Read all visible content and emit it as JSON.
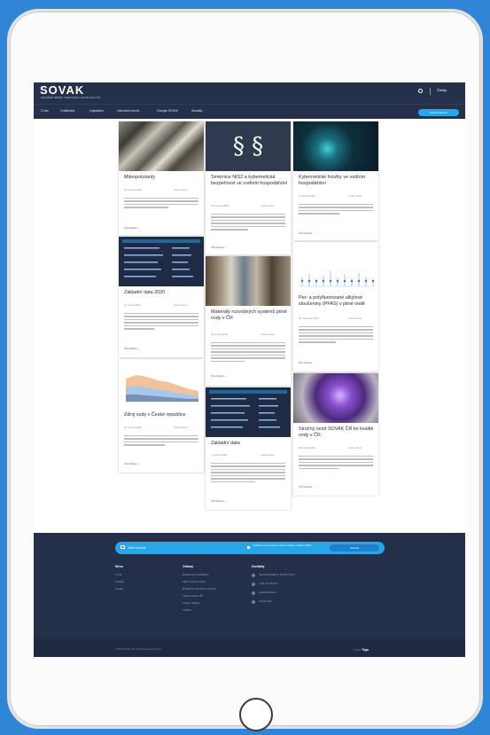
{
  "header": {
    "logo": "SOVAK",
    "logo_subtitle": "SDRUŽENÍ OBORU VODOVODŮ A KANALIZACÍ ČR",
    "lang": "Česky",
    "nav": [
      "O nás",
      "Vzdělávání",
      "Legislativa",
      "Informační servis",
      "Časopis SOVAK",
      "Aktuality"
    ],
    "cta": "Stát se členem"
  },
  "cards": [
    {
      "title": "Mikropolutanty",
      "date": "15. května 2024",
      "category": "Voda a život",
      "more": "Číst článek →"
    },
    {
      "title": "Základní data 2020",
      "date": "13. srpna 2021",
      "category": "Voda a život",
      "more": "Číst článek →"
    },
    {
      "title": "Zdroj vody v České republice",
      "date": "25. června 2021",
      "category": "Voda a život",
      "more": "Číst článek →"
    },
    {
      "title": "Směrnice NIS2 a kybernetická bezpečnost ve vodním hospodářství",
      "date": "22. března 2024",
      "category": "Voda a život",
      "more": "Číst článek →"
    },
    {
      "title": "Materiály rozvodných systémů pitné vody v ČR",
      "date": "23. února 2022",
      "category": "Voda a život",
      "more": "Číst článek →"
    },
    {
      "title": "Základní data",
      "date": "2. března 2021",
      "category": "Voda a život",
      "more": "Číst článek →"
    },
    {
      "title": "Kybernetické hrozby ve vodním hospodářství",
      "date": "3. června 2023",
      "category": "Voda a život",
      "more": "Číst článek →"
    },
    {
      "title": "Per- a polyfluorované alkylové sloučeniny (PFAS) v pitné vodě",
      "date": "30. listopadu 2022",
      "category": "Voda a život",
      "more": "Číst článek →"
    },
    {
      "title": "Stručný úvod SOVAK ČR ke kvalitě vody v ČR",
      "date": "25. ledna 2022",
      "category": "Voda a život",
      "more": "Číst článek →"
    }
  ],
  "newsletter": {
    "label": "Odběr novinek",
    "input_text": "Souhlasím se zpracováním osobních údajů v souladu s GDPR",
    "button": "Odeslat"
  },
  "footer": {
    "col1_title": "Menu",
    "col1_items": [
      "O nás",
      "Aktuality",
      "Kontakt"
    ],
    "col2_title": "Odkazy",
    "col2_items": [
      "Ministerstvo zemědělství",
      "Státní zdravotní ústav",
      "Ministerstvo životního prostředí",
      "Česká inspekce ŽP",
      "Veřejné zakázky",
      "Cookies"
    ],
    "col3_title": "Kontakty",
    "col3_items": [
      "Novotného lávka 5, 110 00 Praha 1",
      "+420 221 082 207",
      "sovak@sovak.cz",
      "Sociální sítě"
    ],
    "copyright": "© 2024 SOVAK ČR. Všechna práva vyhrazena.",
    "created_by_label": "Vytvořilo",
    "created_by": "Trigo"
  },
  "colors": {
    "navy": "#25304a",
    "accent": "#2aa4ea",
    "page_bg": "#2f86d6"
  }
}
